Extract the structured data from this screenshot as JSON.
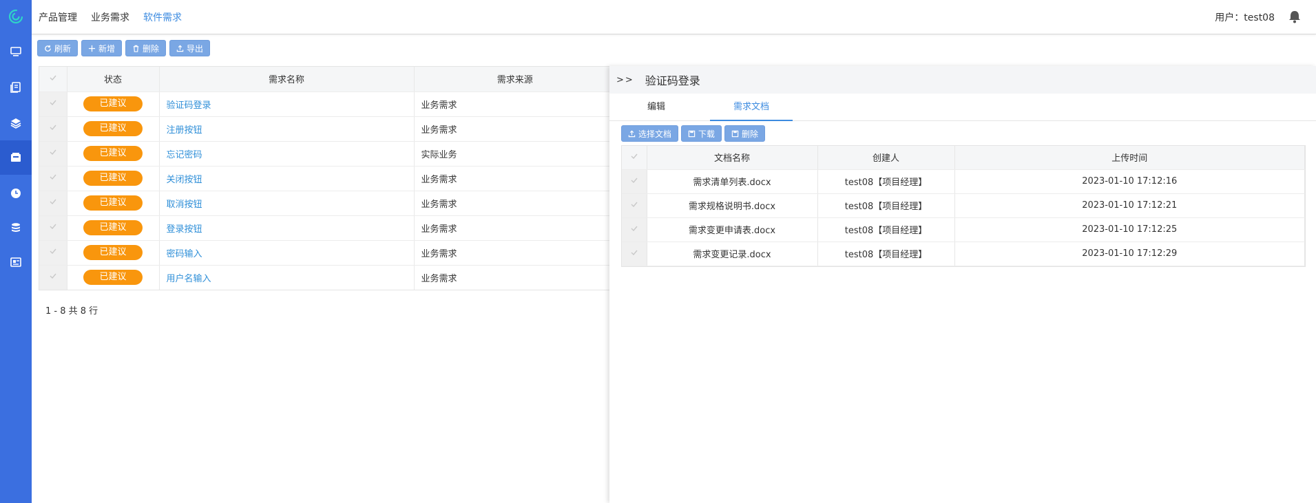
{
  "header": {
    "nav": [
      "产品管理",
      "业务需求",
      "软件需求"
    ],
    "active_nav": 2,
    "user_label": "用户：test08"
  },
  "sidebar": {
    "icons": [
      "monitor-icon",
      "book-icon",
      "layers-icon",
      "inbox-icon",
      "clock-icon",
      "database-icon",
      "card-icon"
    ],
    "active_index": 3
  },
  "toolbar": {
    "refresh": "刷新",
    "add": "新增",
    "delete": "删除",
    "export": "导出"
  },
  "main_table": {
    "columns": [
      "状态",
      "需求名称",
      "需求来源"
    ],
    "rows": [
      {
        "status": "已建议",
        "name": "验证码登录",
        "source": "业务需求"
      },
      {
        "status": "已建议",
        "name": "注册按钮",
        "source": "业务需求"
      },
      {
        "status": "已建议",
        "name": "忘记密码",
        "source": "实际业务"
      },
      {
        "status": "已建议",
        "name": "关闭按钮",
        "source": "业务需求"
      },
      {
        "status": "已建议",
        "name": "取消按钮",
        "source": "业务需求"
      },
      {
        "status": "已建议",
        "name": "登录按钮",
        "source": "业务需求"
      },
      {
        "status": "已建议",
        "name": "密码输入",
        "source": "业务需求"
      },
      {
        "status": "已建议",
        "name": "用户名输入",
        "source": "业务需求"
      }
    ]
  },
  "pager": "1 - 8 共 8 行",
  "panel": {
    "arrows": ">>",
    "title": "验证码登录",
    "tabs": [
      "编辑",
      "需求文档"
    ],
    "active_tab": 1,
    "toolbar": {
      "choose": "选择文档",
      "download": "下载",
      "delete": "删除"
    },
    "doc_columns": [
      "文档名称",
      "创建人",
      "上传时间"
    ],
    "docs": [
      {
        "name": "需求清单列表.docx",
        "creator": "test08【项目经理】",
        "time": "2023-01-10 17:12:16"
      },
      {
        "name": "需求规格说明书.docx",
        "creator": "test08【项目经理】",
        "time": "2023-01-10 17:12:21"
      },
      {
        "name": "需求变更申请表.docx",
        "creator": "test08【项目经理】",
        "time": "2023-01-10 17:12:25"
      },
      {
        "name": "需求变更记录.docx",
        "creator": "test08【项目经理】",
        "time": "2023-01-10 17:12:29"
      }
    ]
  },
  "colors": {
    "sidebar": "#3b6fe0",
    "button": "#7aa7e4",
    "badge": "#f9960d",
    "link": "#2f8fd8",
    "tab_active": "#3c8be0"
  }
}
